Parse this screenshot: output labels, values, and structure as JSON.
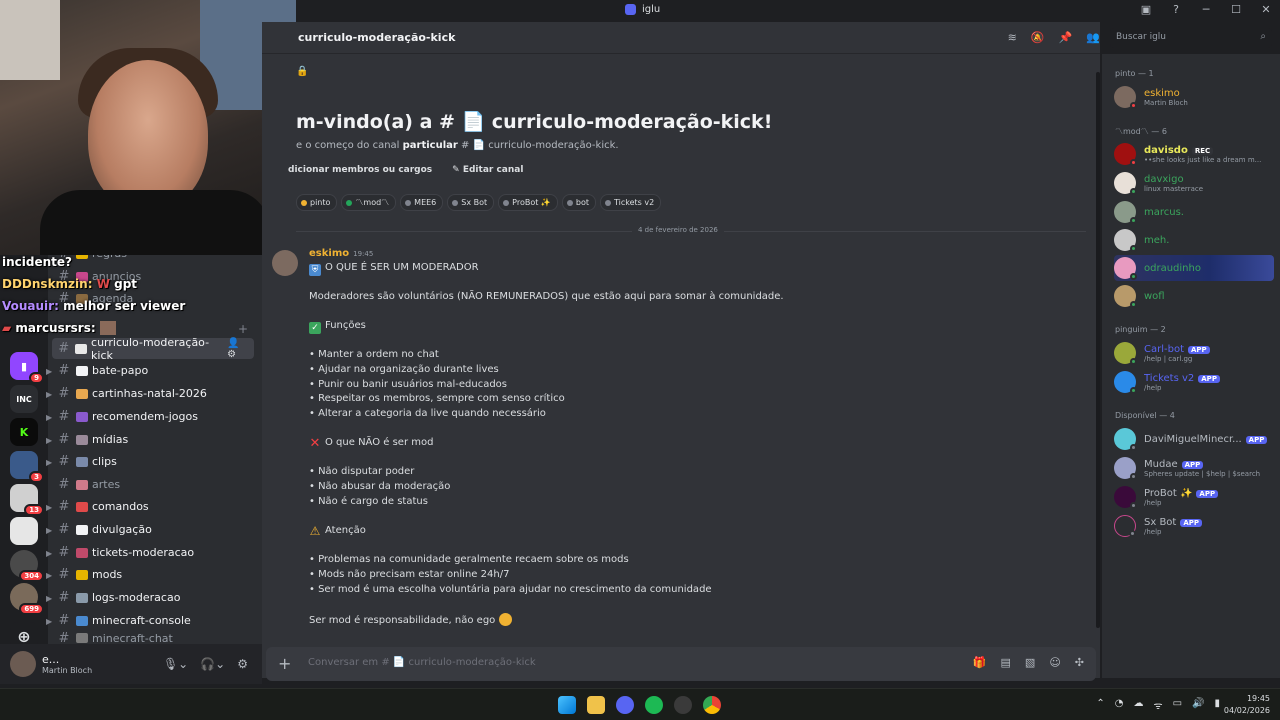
{
  "window": {
    "title": "iglu"
  },
  "channel_header": {
    "name": "curriculo-moderação-kick"
  },
  "search": {
    "placeholder": "Buscar iglu"
  },
  "stream_chat": [
    {
      "text": "incidente?"
    },
    {
      "user": "DDDnskmzin:",
      "text": "W gpt"
    },
    {
      "user": "Vouauir:",
      "text": "melhor ser viewer"
    },
    {
      "user": "marcusrsrs:",
      "text": ""
    }
  ],
  "channels": [
    {
      "name": "regras"
    },
    {
      "name": "anuncios"
    },
    {
      "name": "agenda"
    },
    {
      "name": "curriculo-moderação-kick"
    },
    {
      "name": "bate-papo"
    },
    {
      "name": "cartinhas-natal-2026"
    },
    {
      "name": "recomendem-jogos"
    },
    {
      "name": "mídias"
    },
    {
      "name": "clips"
    },
    {
      "name": "artes"
    },
    {
      "name": "comandos"
    },
    {
      "name": "divulgação"
    },
    {
      "name": "tickets-moderacao"
    },
    {
      "name": "mods"
    },
    {
      "name": "logs-moderacao"
    },
    {
      "name": "minecraft-console"
    },
    {
      "name": "minecraft-chat"
    }
  ],
  "servers": [
    {
      "badge": "9",
      "color": "#9146ff"
    },
    {
      "badge": "",
      "color": "#2b2d31",
      "label": "INC"
    },
    {
      "badge": "",
      "color": "#0b0b0b",
      "label": "K"
    },
    {
      "badge": "3",
      "color": "#3a5a8a"
    },
    {
      "badge": "13",
      "color": "#d0d0d0"
    },
    {
      "badge": "",
      "color": "#e6e6e6"
    },
    {
      "badge": "304",
      "color": "#4a4a4a"
    },
    {
      "badge": "699",
      "color": "#7a6a5a"
    }
  ],
  "user_panel": {
    "name": "e...",
    "sub": "Martin Bloch"
  },
  "welcome": {
    "title": "m-vindo(a) a # 📄 curriculo-moderação-kick!",
    "sub_before": "e o começo do canal ",
    "sub_bold": "particular",
    "sub_after": " # 📄 curriculo-moderação-kick.",
    "add_members": "dicionar membros ou cargos",
    "edit_channel": "Editar canal"
  },
  "roles": [
    {
      "name": "pinto",
      "color": "#f0b232"
    },
    {
      "name": "〽mod〽",
      "color": "#23a55a"
    },
    {
      "name": "MEE6",
      "color": "#80848e"
    },
    {
      "name": "Sx Bot",
      "color": "#80848e"
    },
    {
      "name": "ProBot ✨",
      "color": "#80848e"
    },
    {
      "name": "bot",
      "color": "#80848e"
    },
    {
      "name": "Tickets v2",
      "color": "#80848e"
    }
  ],
  "date_divider": "4 de fevereiro de 2026",
  "message": {
    "author": "eskimo",
    "time": "19:45",
    "lines": [
      "O QUE É SER UM MODERADOR",
      "Moderadores são voluntários (NÃO REMUNERADOS) que estão aqui para somar à comunidade.",
      "Funções",
      "• Manter a ordem no chat",
      "• Ajudar na organização durante lives",
      "• Punir ou banir usuários mal-educados",
      "• Respeitar os membros, sempre com senso crítico",
      "• Alterar a categoria da live quando necessário",
      "O que NÃO é ser mod",
      "• Não disputar poder",
      "• Não abusar da moderação",
      "• Não é cargo de status",
      "Atenção",
      "• Problemas na comunidade geralmente recaem sobre os mods",
      "• Mods não precisam estar online 24h/7",
      "• Ser mod é uma escolha voluntária para ajudar no crescimento da comunidade",
      "Ser mod é responsabilidade, não ego"
    ]
  },
  "composer": {
    "placeholder": "Conversar em # 📄 curriculo-moderação-kick"
  },
  "member_groups": [
    {
      "title": "pinto — 1"
    },
    {
      "title": "〽mod〽 — 6"
    },
    {
      "title": "pinguim — 2"
    },
    {
      "title": "Disponível — 4"
    }
  ],
  "members": [
    {
      "name": "eskimo",
      "sub": "Martin Bloch",
      "color": "#f0b232"
    },
    {
      "name": "davisdo",
      "sub": "••she looks just like a dream m...",
      "color": "#e8e85a",
      "tag": "REC"
    },
    {
      "name": "davxigo",
      "sub": "linux masterrace",
      "color": "#3ba55d"
    },
    {
      "name": "marcus.",
      "sub": "",
      "color": "#3ba55d"
    },
    {
      "name": "meh.",
      "sub": "",
      "color": "#3ba55d"
    },
    {
      "name": "odraudinho",
      "sub": "",
      "color": "#3ba55d"
    },
    {
      "name": "wofl",
      "sub": "",
      "color": "#3ba55d"
    },
    {
      "name": "Carl-bot",
      "sub": "/help | carl.gg",
      "color": "#5865f2",
      "tag": "APP"
    },
    {
      "name": "Tickets v2",
      "sub": "/help",
      "color": "#5865f2",
      "tag": "APP"
    },
    {
      "name": "DaviMiguelMinecr...",
      "sub": "",
      "color": "#b5bac1",
      "tag": "APP"
    },
    {
      "name": "Mudae",
      "sub": "Spheres update | $help | $search",
      "color": "#b5bac1",
      "tag": "APP"
    },
    {
      "name": "ProBot ✨",
      "sub": "/help",
      "color": "#b5bac1",
      "tag": "APP"
    },
    {
      "name": "Sx Bot",
      "sub": "/help",
      "color": "#b5bac1",
      "tag": "APP"
    }
  ],
  "clock": {
    "time": "19:45",
    "date": "04/02/2026"
  }
}
